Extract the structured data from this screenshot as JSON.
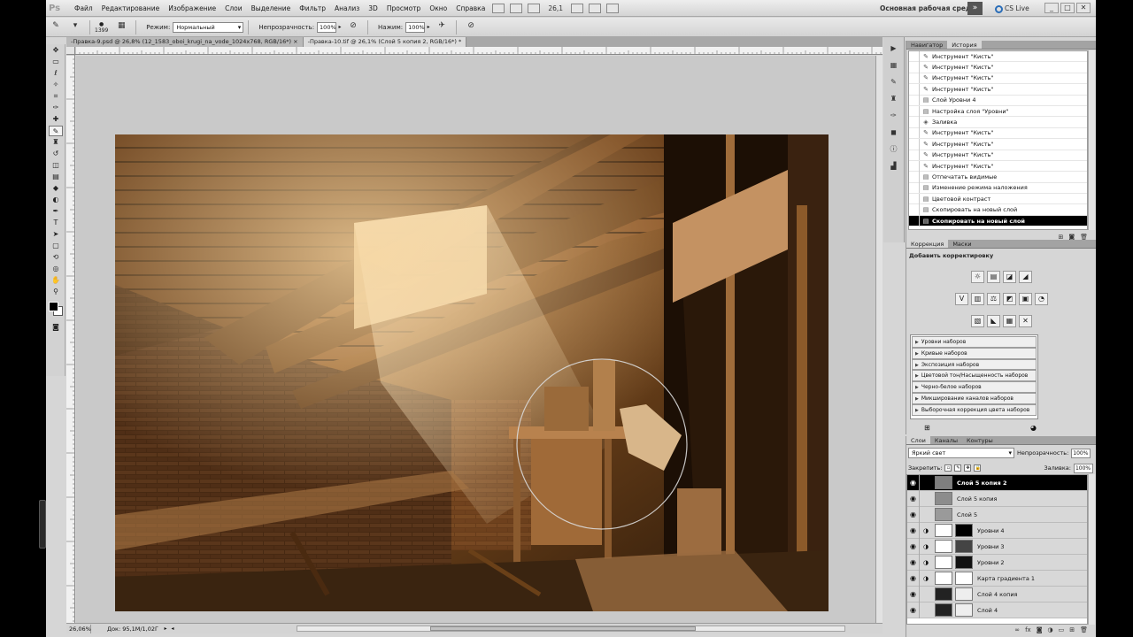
{
  "menubar": {
    "logo": "Ps",
    "items": [
      "Файл",
      "Редактирование",
      "Изображение",
      "Слои",
      "Выделение",
      "Фильтр",
      "Анализ",
      "3D",
      "Просмотр",
      "Окно",
      "Справка"
    ],
    "zoom": "26,1",
    "workspace": "Основная рабочая среда",
    "workspace_arrow": "»",
    "cs_live": "CS Live",
    "window_buttons": [
      "_",
      "□",
      "✕"
    ]
  },
  "options": {
    "brush_size": "1399",
    "mode_label": "Режим:",
    "mode_value": "Нормальный",
    "opacity_label": "Непрозрачность:",
    "opacity_value": "100%",
    "flow_label": "Нажим:",
    "flow_value": "100%"
  },
  "tabs": [
    {
      "label": "-Правка-9.psd @ 26,8% (12_1583_oboi_krugi_na_vode_1024x768, RGB/16*) ×",
      "active": false
    },
    {
      "label": "-Правка-10.tif @ 26,1% (Слой 5 копия 2, RGB/16*) *",
      "active": true
    }
  ],
  "status": {
    "zoom": "26,06%",
    "doc": "Док: 95,1M/1,02Г"
  },
  "history": {
    "tabs": [
      "Навигатор",
      "История"
    ],
    "active_tab": "История",
    "items": [
      {
        "icon": "brush",
        "label": "Инструмент \"Кисть\""
      },
      {
        "icon": "brush",
        "label": "Инструмент \"Кисть\""
      },
      {
        "icon": "brush",
        "label": "Инструмент \"Кисть\""
      },
      {
        "icon": "brush",
        "label": "Инструмент \"Кисть\""
      },
      {
        "icon": "doc",
        "label": "Слой Уровни 4"
      },
      {
        "icon": "doc",
        "label": "Настройка слоя \"Уровни\""
      },
      {
        "icon": "bucket",
        "label": "Заливка"
      },
      {
        "icon": "brush",
        "label": "Инструмент \"Кисть\""
      },
      {
        "icon": "brush",
        "label": "Инструмент \"Кисть\""
      },
      {
        "icon": "brush",
        "label": "Инструмент \"Кисть\""
      },
      {
        "icon": "brush",
        "label": "Инструмент \"Кисть\""
      },
      {
        "icon": "doc",
        "label": "Отпечатать видимые"
      },
      {
        "icon": "doc",
        "label": "Изменение режима наложения"
      },
      {
        "icon": "doc",
        "label": "Цветовой контраст"
      },
      {
        "icon": "doc",
        "label": "Скопировать на новый слой"
      },
      {
        "icon": "doc",
        "label": "Скопировать на новый слой",
        "selected": true
      }
    ]
  },
  "adjustments": {
    "tabs": [
      "Коррекция",
      "Маски"
    ],
    "active_tab": "Коррекция",
    "title": "Добавить корректировку",
    "row1": [
      "☼",
      "▤",
      "◪",
      "◢"
    ],
    "row2": [
      "V",
      "▥",
      "⚖",
      "◩",
      "▣",
      "◔"
    ],
    "row3": [
      "▧",
      "◣",
      "▦",
      "✕"
    ],
    "presets": [
      "Уровни наборов",
      "Кривые наборов",
      "Экспозиция наборов",
      "Цветовой тон/Насыщенность наборов",
      "Черно-белое наборов",
      "Микширование каналов наборов",
      "Выборочная коррекция цвета наборов"
    ]
  },
  "layers": {
    "tabs": [
      "Слои",
      "Каналы",
      "Контуры"
    ],
    "active_tab": "Слои",
    "blend_mode": "Яркий свет",
    "opacity_label": "Непрозрачность:",
    "opacity_value": "100%",
    "lock_label": "Закрепить:",
    "fill_label": "Заливка:",
    "fill_value": "100%",
    "items": [
      {
        "name": "Слой 5 копия 2",
        "type": "pixel",
        "selected": true,
        "thumb": "#7f7f7f"
      },
      {
        "name": "Слой 5 копия",
        "type": "pixel",
        "thumb": "#8c8c8c"
      },
      {
        "name": "Слой 5",
        "type": "pixel",
        "thumb": "#9a9a9a"
      },
      {
        "name": "Уровни 4",
        "type": "adjust",
        "thumb": "#fff",
        "mask": "#000"
      },
      {
        "name": "Уровни 3",
        "type": "adjust",
        "thumb": "#fff",
        "mask": "#444"
      },
      {
        "name": "Уровни 2",
        "type": "adjust",
        "thumb": "#fff",
        "mask": "#111"
      },
      {
        "name": "Карта градиента 1",
        "type": "adjust",
        "thumb": "#fff",
        "mask": "#fff"
      },
      {
        "name": "Слой 4 копия",
        "type": "pixel",
        "thumb": "#222",
        "mask": "#eee"
      },
      {
        "name": "Слой 4",
        "type": "pixel",
        "thumb": "#222",
        "mask": "#eee"
      }
    ]
  }
}
